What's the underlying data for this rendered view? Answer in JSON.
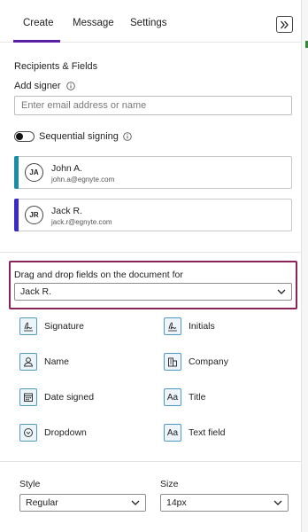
{
  "tabs": [
    {
      "label": "Create",
      "active": true
    },
    {
      "label": "Message",
      "active": false
    },
    {
      "label": "Settings",
      "active": false
    }
  ],
  "collapse_button": {
    "icon": "double-chevron-right-icon"
  },
  "recipients": {
    "section_title": "Recipients & Fields",
    "add_signer_label": "Add signer",
    "email_placeholder": "Enter email address or name",
    "sequential_label": "Sequential signing",
    "sequential_enabled": false
  },
  "signers": [
    {
      "initials": "JA",
      "name": "John A.",
      "email": "john.a@egnyte.com",
      "color": "#1a8ea6"
    },
    {
      "initials": "JR",
      "name": "Jack R.",
      "email": "jack.r@egnyte.com",
      "color": "#3b2bc9"
    }
  ],
  "fields_panel": {
    "label": "Drag and drop fields on the document for",
    "selected_recipient": "Jack R.",
    "border_color": "#8a2358",
    "fields": [
      {
        "label": "Signature",
        "icon": "signature-icon"
      },
      {
        "label": "Initials",
        "icon": "initials-icon"
      },
      {
        "label": "Name",
        "icon": "person-icon"
      },
      {
        "label": "Company",
        "icon": "building-icon"
      },
      {
        "label": "Date signed",
        "icon": "calendar-icon"
      },
      {
        "label": "Title",
        "icon": "text-aa-icon",
        "glyph": "Aa"
      },
      {
        "label": "Dropdown",
        "icon": "dropdown-circle-icon"
      },
      {
        "label": "Text field",
        "icon": "text-aa-icon",
        "glyph": "Aa"
      }
    ]
  },
  "style": {
    "style_label": "Style",
    "style_value": "Regular",
    "size_label": "Size",
    "size_value": "14px"
  },
  "colors": {
    "tab_accent": "#5b1fa6",
    "field_icon_border": "#4d9cc8"
  }
}
